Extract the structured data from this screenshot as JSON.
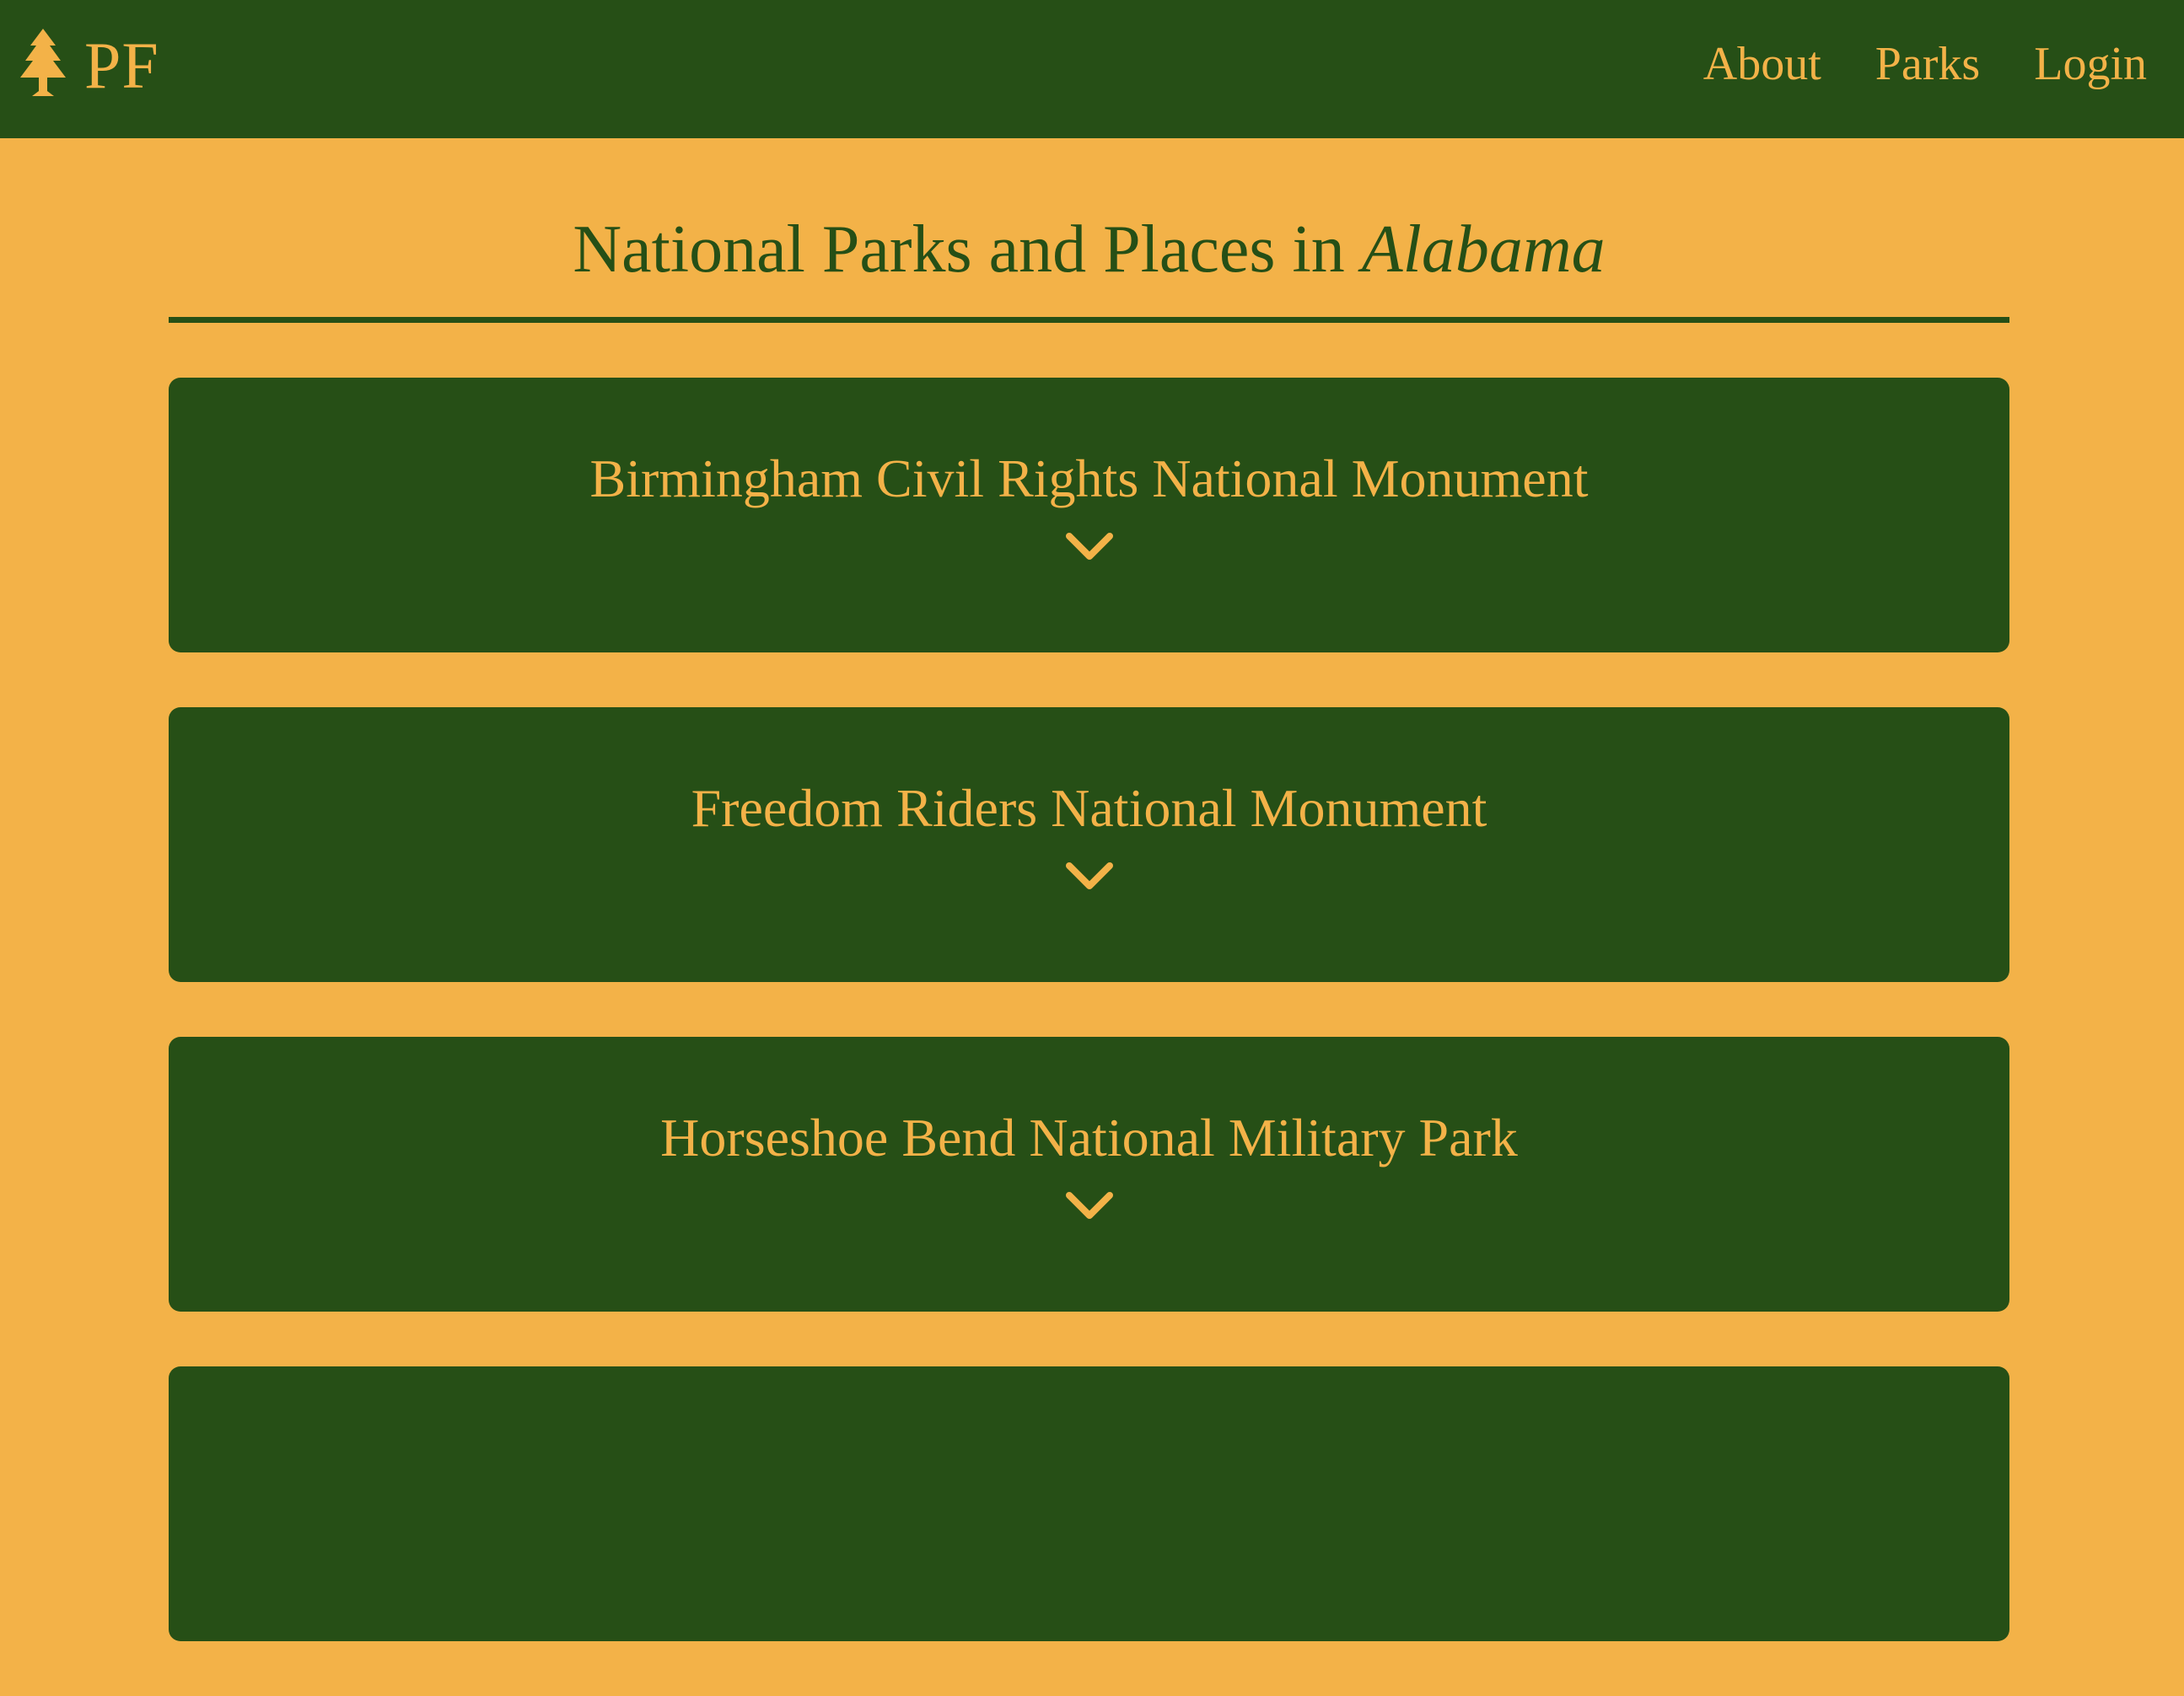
{
  "brand": {
    "icon": "pine-tree-icon",
    "text": "PF"
  },
  "nav": {
    "links": [
      {
        "label": "About"
      },
      {
        "label": "Parks"
      },
      {
        "label": "Login"
      }
    ]
  },
  "header": {
    "title_prefix": "National Parks and Places in ",
    "state": "Alabama"
  },
  "parks": [
    {
      "name": "Birmingham Civil Rights National Monument"
    },
    {
      "name": "Freedom Riders National Monument"
    },
    {
      "name": "Horseshoe Bend National Military Park"
    },
    {
      "name": ""
    }
  ],
  "colors": {
    "dark_green": "#264f16",
    "golden": "#f3b248"
  },
  "icons": {
    "expand": "chevron-down-icon"
  }
}
